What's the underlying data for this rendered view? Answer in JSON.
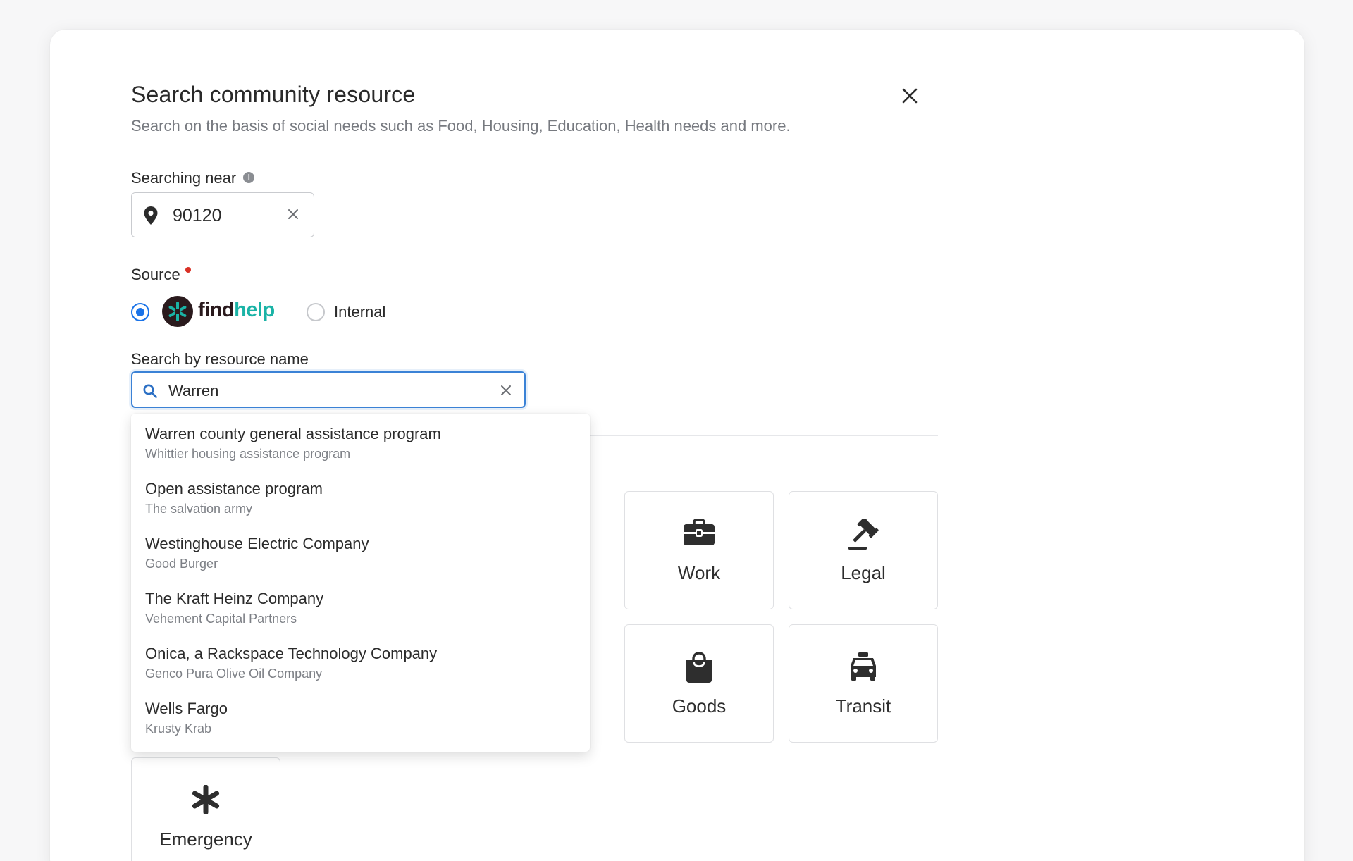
{
  "dialog": {
    "title": "Search community resource",
    "subtitle": "Search on the basis of social needs such as Food, Housing, Education, Health needs and more."
  },
  "location": {
    "label": "Searching near",
    "value": "90120"
  },
  "source": {
    "label": "Source",
    "options": [
      {
        "brand_part1": "find",
        "brand_part2": "help",
        "selected": true
      },
      {
        "label": "Internal",
        "selected": false
      }
    ]
  },
  "resource_search": {
    "label": "Search by resource name",
    "value": "Warren"
  },
  "suggestions": [
    {
      "name": "Warren county general assistance program",
      "org": "Whittier housing assistance program"
    },
    {
      "name": "Open assistance program",
      "org": "The salvation army"
    },
    {
      "name": "Westinghouse Electric Company",
      "org": "Good Burger"
    },
    {
      "name": "The Kraft Heinz Company",
      "org": "Vehement Capital Partners"
    },
    {
      "name": "Onica, a Rackspace Technology Company",
      "org": "Genco Pura Olive Oil Company"
    },
    {
      "name": "Wells Fargo",
      "org": "Krusty Krab"
    }
  ],
  "categories": [
    {
      "label": "Work",
      "icon": "briefcase-icon"
    },
    {
      "label": "Legal",
      "icon": "gavel-icon"
    },
    {
      "label": "Goods",
      "icon": "shopping-bag-icon"
    },
    {
      "label": "Transit",
      "icon": "taxi-icon"
    },
    {
      "label": "Emergency",
      "icon": "asterisk-icon"
    }
  ],
  "colors": {
    "accent": "#1a73e8",
    "findhelp_teal": "#1ab3a6",
    "required": "#d93025"
  }
}
